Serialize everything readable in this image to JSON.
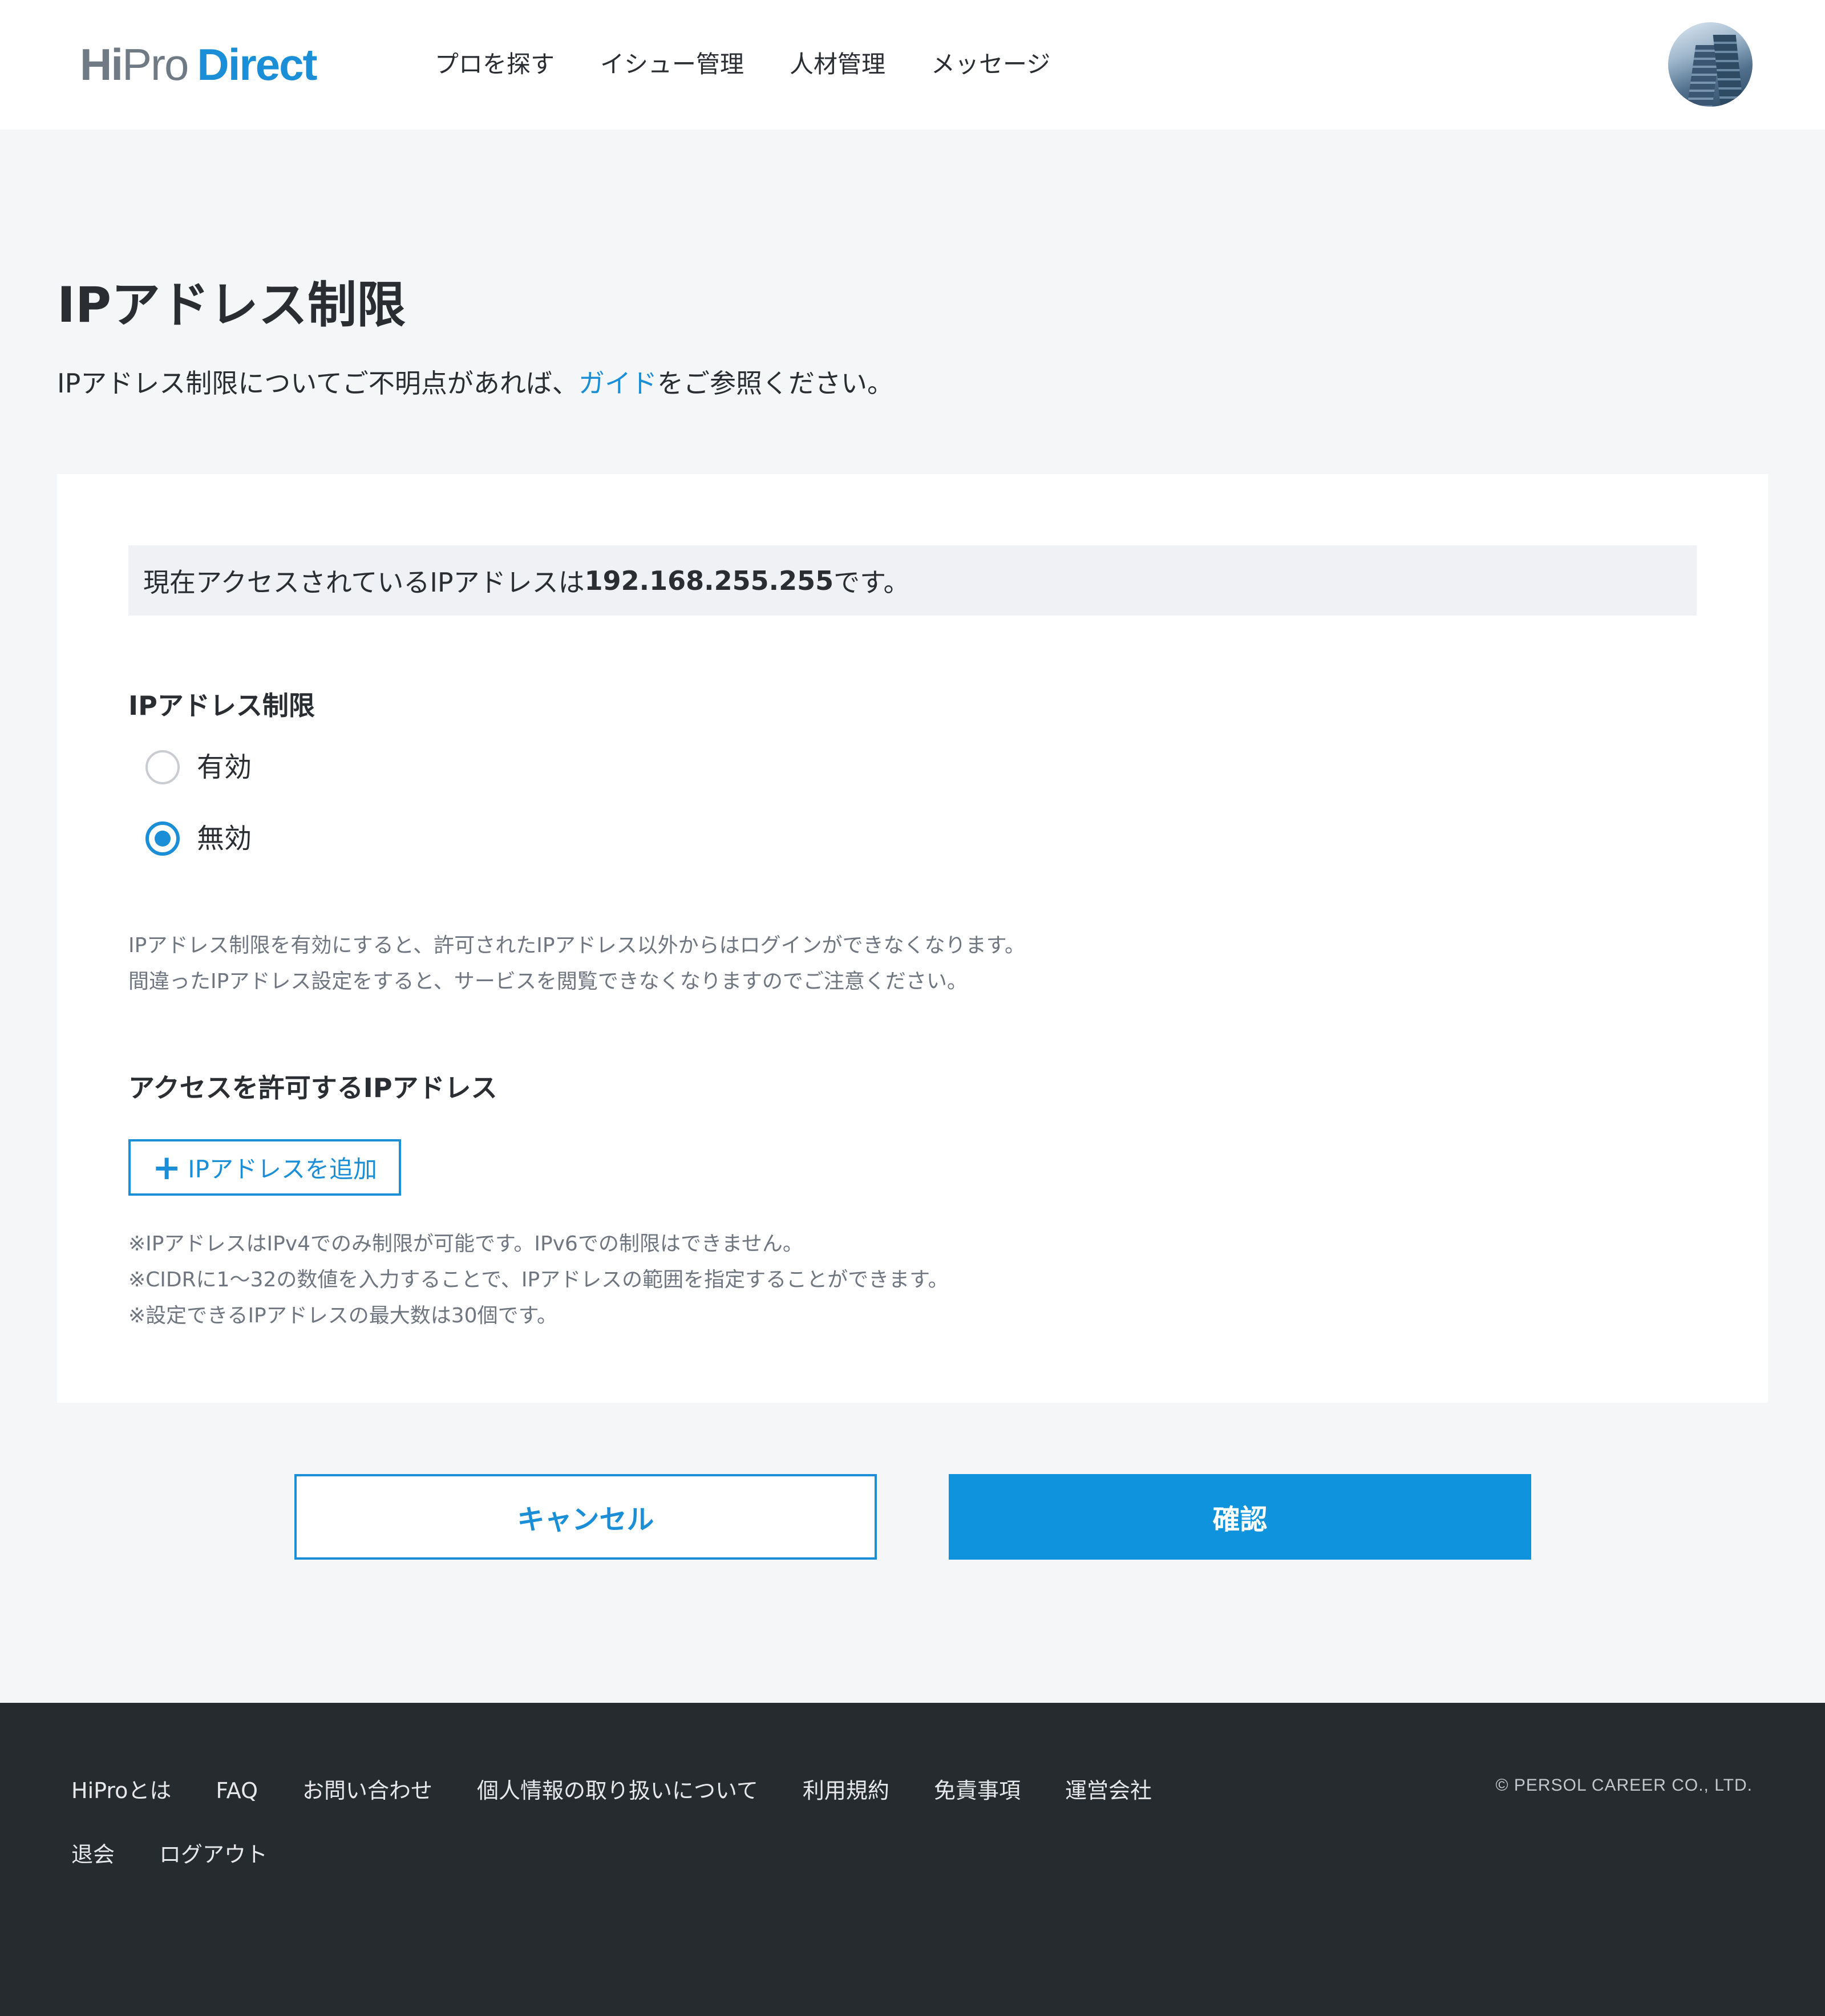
{
  "header": {
    "logo": {
      "hi": "Hi",
      "pro": "Pro",
      "direct": "Direct"
    },
    "nav": [
      "プロを探す",
      "イシュー管理",
      "人材管理",
      "メッセージ"
    ],
    "avatar_icon": "user-avatar-building-photo"
  },
  "page": {
    "title": "IPアドレス制限",
    "description_prefix": "IPアドレス制限についてご不明点があれば、",
    "guide_link": "ガイド",
    "description_suffix": "をご参照ください。"
  },
  "card": {
    "ip_banner": {
      "prefix": "現在アクセスされているIPアドレスは",
      "ip": "192.168.255.255",
      "suffix": "です。"
    },
    "restriction": {
      "label": "IPアドレス制限",
      "options": [
        {
          "label": "有効",
          "checked": false
        },
        {
          "label": "無効",
          "checked": true
        }
      ],
      "notes": [
        "IPアドレス制限を有効にすると、許可されたIPアドレス以外からはログインができなくなります。",
        "間違ったIPアドレス設定をすると、サービスを閲覧できなくなりますのでご注意ください。"
      ]
    },
    "allowed": {
      "label": "アクセスを許可するIPアドレス",
      "add_button": "IPアドレスを追加",
      "add_icon": "plus-icon",
      "notes": [
        "※IPアドレスはIPv4でのみ制限が可能です。IPv6での制限はできません。",
        "※CIDRに1〜32の数値を入力することで、IPアドレスの範囲を指定することができます。",
        "※設定できるIPアドレスの最大数は30個です。"
      ]
    }
  },
  "actions": {
    "cancel": "キャンセル",
    "confirm": "確認"
  },
  "footer": {
    "row1": [
      "HiProとは",
      "FAQ",
      "お問い合わせ",
      "個人情報の取り扱いについて",
      "利用規約",
      "免責事項",
      "運営会社"
    ],
    "row2": [
      "退会",
      "ログアウト"
    ],
    "copyright": "© PERSOL CAREER CO., LTD."
  },
  "colors": {
    "accent": "#0e93dc",
    "text": "#2a2e33",
    "page_bg": "#f5f6f8",
    "footer_bg": "#262b30"
  }
}
